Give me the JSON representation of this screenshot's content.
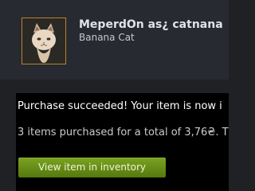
{
  "item": {
    "name": "MeperdOn as¿ catnana",
    "type": "Banana Cat",
    "icon": "banana-cat-icon"
  },
  "purchase": {
    "message": "Purchase succeeded! Your item is now i",
    "summary": "3 items purchased for a total of 3,76₴. T",
    "button_label": "View item in inventory"
  },
  "colors": {
    "background": "#1f2125",
    "header": "#272a30",
    "panel": "#000000",
    "avatar_border": "#b8832b",
    "button": "#6b8f1a"
  }
}
